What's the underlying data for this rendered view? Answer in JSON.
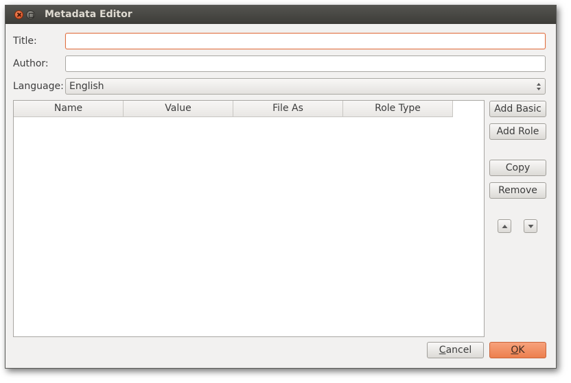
{
  "window": {
    "title": "Metadata Editor"
  },
  "form": {
    "title_label": "Title:",
    "title_value": "",
    "author_label": "Author:",
    "author_value": "",
    "language_label": "Language:",
    "language_value": "English"
  },
  "table": {
    "columns": [
      "Name",
      "Value",
      "File As",
      "Role Type"
    ],
    "rows": []
  },
  "side_buttons": {
    "add_basic": "Add Basic",
    "add_role": "Add Role",
    "copy": "Copy",
    "remove": "Remove"
  },
  "dialog_buttons": {
    "cancel_mnemonic": "C",
    "cancel_rest": "ancel",
    "ok_mnemonic": "O",
    "ok_rest": "K"
  },
  "icons": {
    "close": "close-icon",
    "maximize": "maximize-icon",
    "move_up": "triangle-up-icon",
    "move_down": "triangle-down-icon",
    "combo": "updown-arrows-icon"
  },
  "colors": {
    "accent": "#ec7f4e",
    "focus_border": "#e07040",
    "titlebar": "#3d3c38"
  }
}
